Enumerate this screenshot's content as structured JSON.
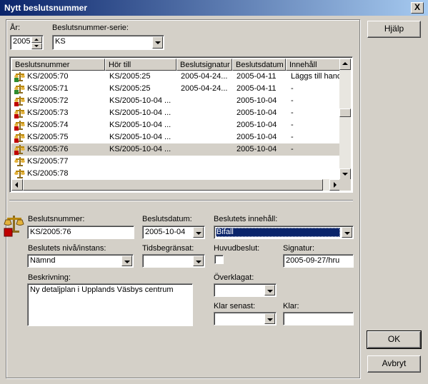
{
  "window": {
    "title": "Nytt beslutsnummer",
    "close_glyph": "X"
  },
  "filters": {
    "year_label": "År:",
    "year_value": "2005",
    "series_label": "Beslutsnummer-serie:",
    "series_value": "KS"
  },
  "list": {
    "columns": [
      "Beslutsnummer",
      "Hör till",
      "Beslutsignatur",
      "Beslutsdatum",
      "Innehåll"
    ],
    "rows": [
      {
        "nr": "KS/2005:70",
        "hor_till": "KS/2005:25",
        "signatur": "2005-04-24...",
        "datum": "2005-04-11",
        "innehall": "Läggs till handli",
        "icon": "approved-decision-icon"
      },
      {
        "nr": "KS/2005:71",
        "hor_till": "KS/2005:25",
        "signatur": "2005-04-24...",
        "datum": "2005-04-11",
        "innehall": "-",
        "icon": "approved-decision-icon"
      },
      {
        "nr": "KS/2005:72",
        "hor_till": "KS/2005-10-04 ...",
        "signatur": "",
        "datum": "2005-10-04",
        "innehall": "-",
        "icon": "pending-decision-icon"
      },
      {
        "nr": "KS/2005:73",
        "hor_till": "KS/2005-10-04 ...",
        "signatur": "",
        "datum": "2005-10-04",
        "innehall": "-",
        "icon": "pending-decision-icon"
      },
      {
        "nr": "KS/2005:74",
        "hor_till": "KS/2005-10-04 ...",
        "signatur": "",
        "datum": "2005-10-04",
        "innehall": "-",
        "icon": "pending-decision-icon"
      },
      {
        "nr": "KS/2005:75",
        "hor_till": "KS/2005-10-04 ...",
        "signatur": "",
        "datum": "2005-10-04",
        "innehall": "-",
        "icon": "pending-decision-icon"
      },
      {
        "nr": "KS/2005:76",
        "hor_till": "KS/2005-10-04 ...",
        "signatur": "",
        "datum": "2005-10-04",
        "innehall": "-",
        "icon": "pending-decision-icon"
      },
      {
        "nr": "KS/2005:77",
        "hor_till": "",
        "signatur": "",
        "datum": "",
        "innehall": "",
        "icon": "decision-icon"
      },
      {
        "nr": "KS/2005:78",
        "hor_till": "",
        "signatur": "",
        "datum": "",
        "innehall": "",
        "icon": "decision-icon"
      }
    ],
    "selected_index": 6
  },
  "form": {
    "beslutsnummer_label": "Beslutsnummer:",
    "beslutsnummer_value": "KS/2005:76",
    "beslutsdatum_label": "Beslutsdatum:",
    "beslutsdatum_value": "2005-10-04",
    "innehall_label": "Beslutets innehåll:",
    "innehall_value": "Bifall",
    "niva_label": "Beslutets nivå/instans:",
    "niva_value": "Nämnd",
    "tidsbegransat_label": "Tidsbegränsat:",
    "tidsbegransat_value": "",
    "huvudbeslut_label": "Huvudbeslut:",
    "signatur_label": "Signatur:",
    "signatur_value": "2005-09-27/hru",
    "beskrivning_label": "Beskrivning:",
    "beskrivning_value": "Ny detaljplan i Upplands Väsbys centrum",
    "overklagat_label": "Överklagat:",
    "overklagat_value": "",
    "klar_senast_label": "Klar senast:",
    "klar_senast_value": "",
    "klar_label": "Klar:",
    "klar_value": ""
  },
  "buttons": {
    "help": "Hjälp",
    "ok": "OK",
    "cancel": "Avbryt"
  },
  "colors": {
    "title_start": "#0a246a",
    "title_end": "#a6caf0",
    "selection": "#0a246a",
    "face": "#d4d0c8"
  }
}
